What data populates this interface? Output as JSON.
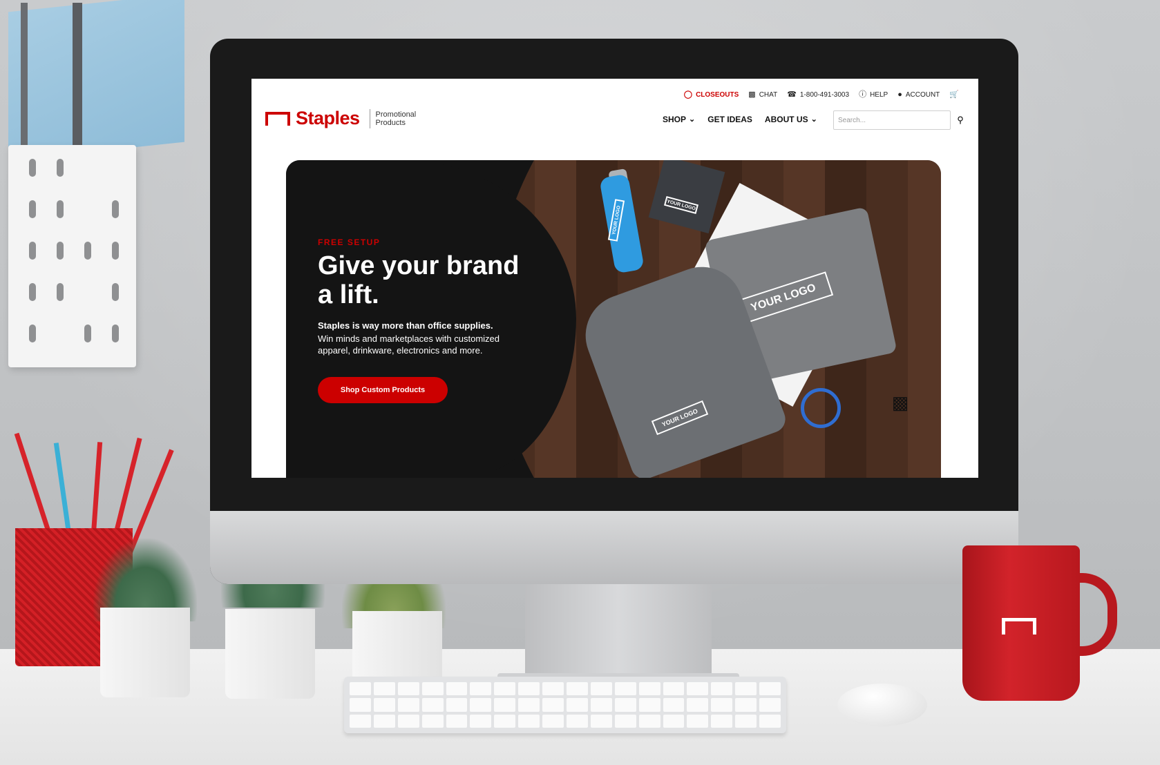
{
  "utility_bar": {
    "closeouts": "CLOSEOUTS",
    "chat": "CHAT",
    "phone": "1-800-491-3003",
    "help": "HELP",
    "account": "ACCOUNT"
  },
  "brand": {
    "name": "Staples",
    "sub": "Promotional Products",
    "color": "#cc0000"
  },
  "nav": {
    "shop": "SHOP",
    "get_ideas": "GET IDEAS",
    "about_us": "ABOUT US"
  },
  "search": {
    "placeholder": "Search..."
  },
  "hero": {
    "eyebrow": "FREE SETUP",
    "headline": "Give your brand a lift.",
    "desc_bold": "Staples is way more than office supplies.",
    "desc": "Win minds and marketplaces with customized apparel, drinkware, electronics and more.",
    "cta": "Shop Custom Products",
    "product_logo": "YOUR LOGO"
  },
  "icons": {
    "closeouts": "tag-icon",
    "chat": "chat-icon",
    "phone": "phone-icon",
    "help": "help-icon",
    "account": "account-icon",
    "cart": "cart-icon",
    "search": "search-icon",
    "chat_fab": "chat-bubble-icon"
  }
}
